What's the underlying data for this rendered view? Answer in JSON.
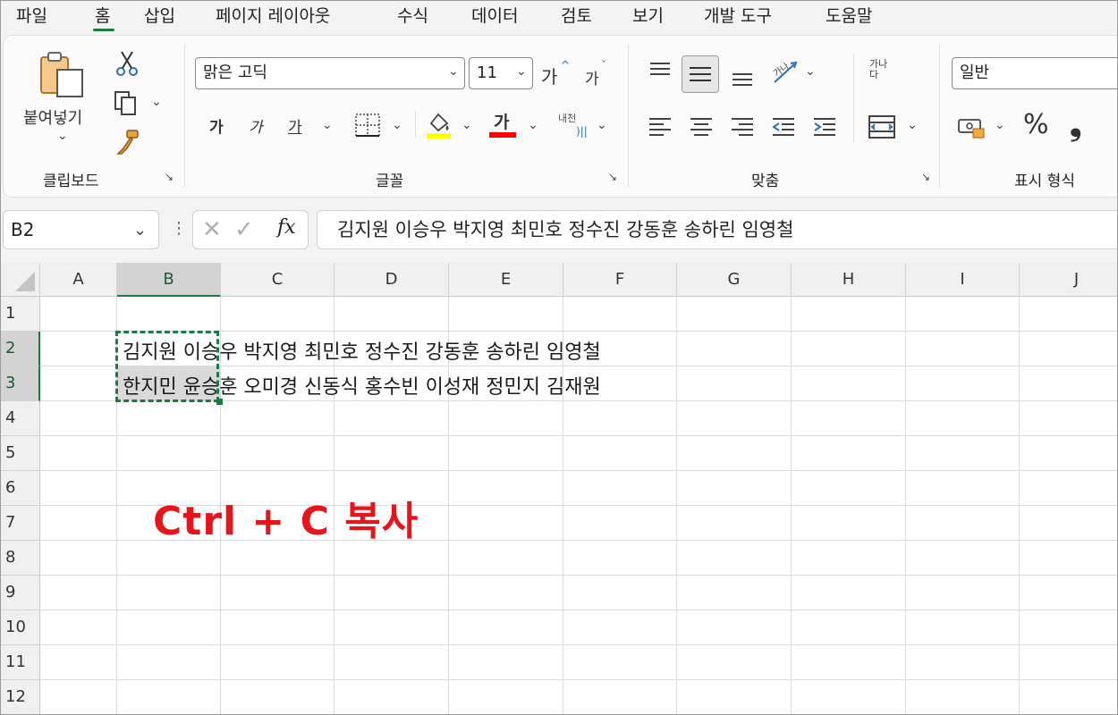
{
  "menu": {
    "tabs": [
      "파일",
      "홈",
      "삽입",
      "페이지 레이아웃",
      "수식",
      "데이터",
      "검토",
      "보기",
      "개발 도구",
      "도움말"
    ],
    "active_tab": "홈"
  },
  "ribbon": {
    "clipboard": {
      "paste_label": "붙여넣기",
      "group_label": "클립보드",
      "icons": [
        "paste-icon",
        "cut-icon",
        "copy-icon",
        "format-painter-icon"
      ]
    },
    "font": {
      "group_label": "글꼴",
      "font_name": "맑은 고딕",
      "font_size": "11",
      "grow_label": "가",
      "shrink_label": "가",
      "bold_label": "가",
      "italic_label": "가",
      "underline_label": "가",
      "font_color_label": "가",
      "phonetic_label": "내천",
      "fill_color": "#ffff00",
      "font_color": "#ff0000"
    },
    "alignment": {
      "group_label": "맞춤",
      "wrap_label": "가나다"
    },
    "number": {
      "group_label": "표시 형식",
      "format": "일반",
      "percent": "%",
      "comma": "❟"
    }
  },
  "formula_bar": {
    "name_box": "B2",
    "fx_label": "fx",
    "content": "김지원 이승우 박지영 최민호 정수진 강동훈 송하린 임영철"
  },
  "sheet": {
    "columns": [
      "A",
      "B",
      "C",
      "D",
      "E",
      "F",
      "G",
      "H",
      "I",
      "J"
    ],
    "rows": [
      "1",
      "2",
      "3",
      "4",
      "5",
      "6",
      "7",
      "8",
      "9",
      "10",
      "11",
      "12"
    ],
    "selected_cell": "B2",
    "cells": {
      "B2": "김지원 이승우 박지영 최민호 정수진 강동훈 송하린 임영철",
      "B3": "한지민 윤승훈 오미경 신동식 홍수빈 이성재 정민지 김재원"
    },
    "accent_color": "#1e7a45"
  },
  "annotation": {
    "text": "Ctrl + C 복사",
    "color": "#e8141c"
  }
}
